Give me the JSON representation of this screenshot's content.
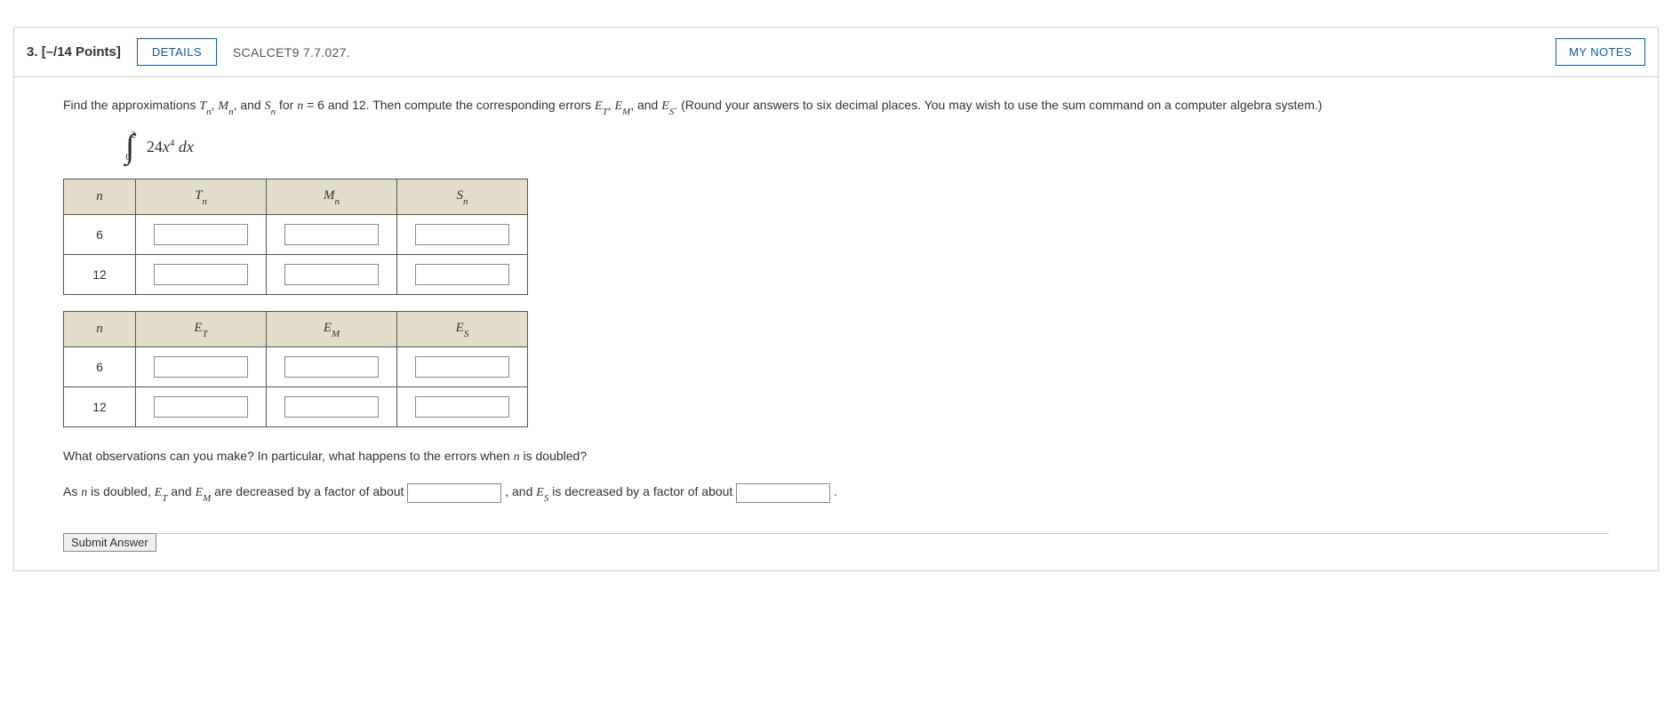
{
  "header": {
    "number": "3.",
    "points": "[–/14 Points]",
    "details_label": "DETAILS",
    "source": "SCALCET9 7.7.027.",
    "my_notes_label": "MY NOTES"
  },
  "instruction": {
    "p1_a": "Find the approximations ",
    "Tn": "T",
    "Tn_sub": "n",
    "c1": ", ",
    "Mn": "M",
    "Mn_sub": "n",
    "c2": ", and ",
    "Sn": "S",
    "Sn_sub": "n",
    "p1_b": " for ",
    "n_eq": "n",
    "eq_txt": " = 6 and 12. Then compute the corresponding errors ",
    "ET": "E",
    "ET_sub": "T",
    "c3": ", ",
    "EM": "E",
    "EM_sub": "M",
    "c4": ", and ",
    "ES": "E",
    "ES_sub": "S",
    "p1_c": ". (Round your answers to six decimal places. You may wish to use the sum command on a computer algebra system.)"
  },
  "integral": {
    "upper": "2",
    "lower": "0",
    "coeff": "24",
    "var": "x",
    "exp": "4",
    "dx": " dx"
  },
  "table1": {
    "h_n": "n",
    "h_T": "T",
    "h_T_sub": "n",
    "h_M": "M",
    "h_M_sub": "n",
    "h_S": "S",
    "h_S_sub": "n",
    "rows": [
      {
        "n": "6"
      },
      {
        "n": "12"
      }
    ]
  },
  "table2": {
    "h_n": "n",
    "h_ET": "E",
    "h_ET_sub": "T",
    "h_EM": "E",
    "h_EM_sub": "M",
    "h_ES": "E",
    "h_ES_sub": "S",
    "rows": [
      {
        "n": "6"
      },
      {
        "n": "12"
      }
    ]
  },
  "observation": {
    "q": "What observations can you make? In particular, what happens to the errors when ",
    "n_ital": "n",
    "q2": " is doubled?",
    "line_a": "As ",
    "n_ital2": "n",
    "line_b": " is doubled, ",
    "ET": "E",
    "ET_sub": "T",
    "and1": " and ",
    "EM": "E",
    "EM_sub": "M",
    "line_c": " are decreased by a factor of about ",
    "comma": " , and ",
    "ES": "E",
    "ES_sub": "S",
    "line_d": " is decreased by a factor of about ",
    "period": " ."
  },
  "submit_label": "Submit Answer"
}
